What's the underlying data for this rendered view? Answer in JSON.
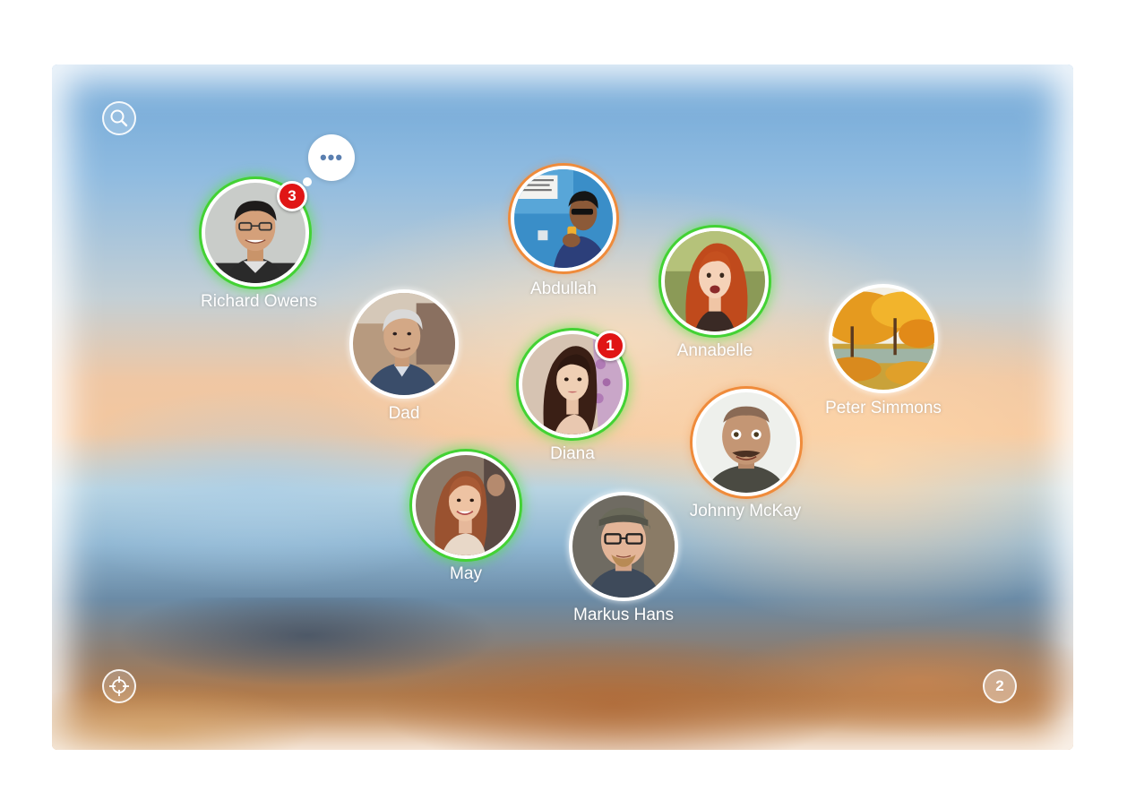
{
  "contacts": [
    {
      "id": "richard-owens",
      "name": "Richard Owens",
      "ring": "green",
      "badge": "3",
      "has_bubble": true
    },
    {
      "id": "abdullah",
      "name": "Abdullah",
      "ring": "orange"
    },
    {
      "id": "annabelle",
      "name": "Annabelle",
      "ring": "green"
    },
    {
      "id": "dad",
      "name": "Dad",
      "ring": "white"
    },
    {
      "id": "diana",
      "name": "Diana",
      "ring": "green",
      "badge": "1"
    },
    {
      "id": "peter-simmons",
      "name": "Peter Simmons",
      "ring": "white"
    },
    {
      "id": "johnny-mckay",
      "name": "Johnny McKay",
      "ring": "orange"
    },
    {
      "id": "may",
      "name": "May",
      "ring": "green"
    },
    {
      "id": "markus-hans",
      "name": "Markus Hans",
      "ring": "white"
    }
  ],
  "bubble": {
    "label": "•••"
  },
  "controls": {
    "search_icon": "search-icon",
    "locate_icon": "crosshair-icon",
    "page_count": "2"
  },
  "colors": {
    "online_ring": "#43d234",
    "away_ring": "#ef8b3b",
    "badge": "#e01515"
  }
}
